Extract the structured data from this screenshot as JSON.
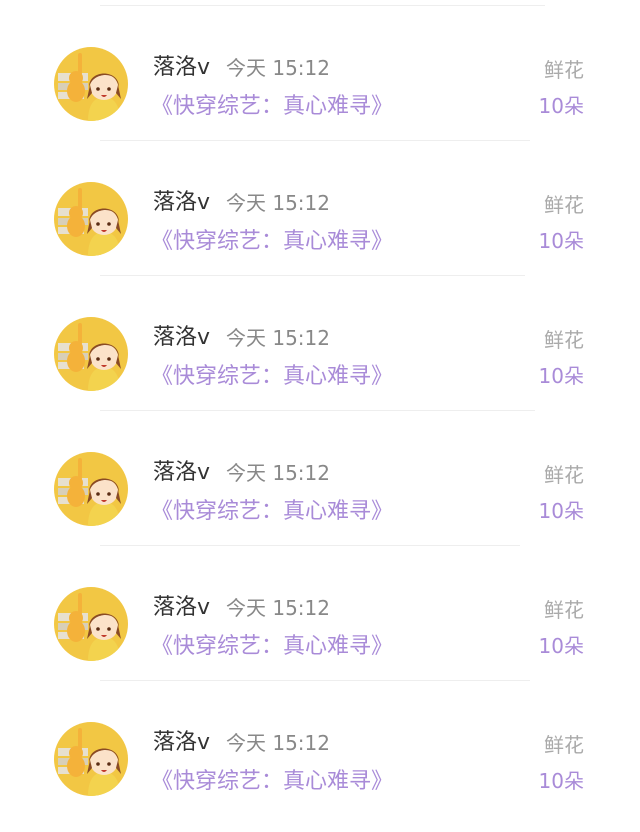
{
  "rows": [
    {
      "user": "落洛v",
      "time": "今天 15:12",
      "book": "《快穿综艺：真心难寻》",
      "gift_type": "鲜花",
      "gift_count": "10朵"
    },
    {
      "user": "落洛v",
      "time": "今天 15:12",
      "book": "《快穿综艺：真心难寻》",
      "gift_type": "鲜花",
      "gift_count": "10朵"
    },
    {
      "user": "落洛v",
      "time": "今天 15:12",
      "book": "《快穿综艺：真心难寻》",
      "gift_type": "鲜花",
      "gift_count": "10朵"
    },
    {
      "user": "落洛v",
      "time": "今天 15:12",
      "book": "《快穿综艺：真心难寻》",
      "gift_type": "鲜花",
      "gift_count": "10朵"
    },
    {
      "user": "落洛v",
      "time": "今天 15:12",
      "book": "《快穿综艺：真心难寻》",
      "gift_type": "鲜花",
      "gift_count": "10朵"
    },
    {
      "user": "落洛v",
      "time": "今天 15:12",
      "book": "《快穿综艺：真心难寻》",
      "gift_type": "鲜花",
      "gift_count": "10朵"
    }
  ],
  "colors": {
    "accent": "#a98bd8",
    "avatar_bg": "#f2c744"
  },
  "icons": {
    "avatar": "anime-girl-avatar"
  }
}
